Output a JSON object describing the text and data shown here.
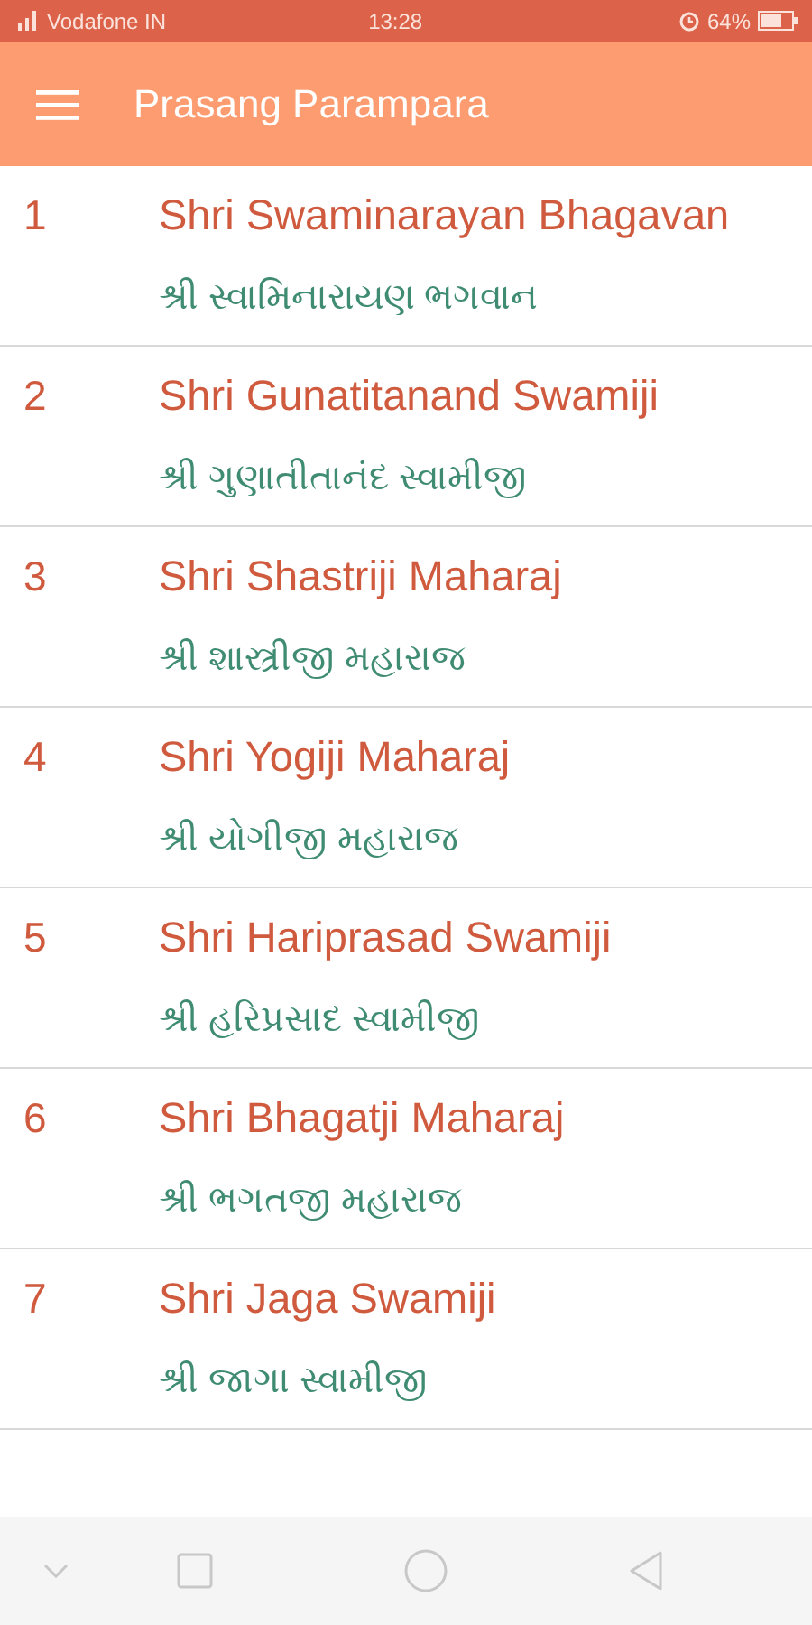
{
  "status_bar": {
    "carrier": "Vodafone IN",
    "time": "13:28",
    "battery": "64%"
  },
  "app_bar": {
    "title": "Prasang Parampara"
  },
  "items": [
    {
      "number": "1",
      "title": "Shri Swaminarayan Bhagavan",
      "subtitle": "શ્રી સ્વામિનારાયણ ભગવાન"
    },
    {
      "number": "2",
      "title": "Shri Gunatitanand Swamiji",
      "subtitle": "શ્રી ગુણાતીતાનંદ સ્વામીજી"
    },
    {
      "number": "3",
      "title": "Shri Shastriji Maharaj",
      "subtitle": "શ્રી શાસ્ત્રીજી મહારાજ"
    },
    {
      "number": "4",
      "title": "Shri Yogiji Maharaj",
      "subtitle": "શ્રી યોગીજી મહારાજ"
    },
    {
      "number": "5",
      "title": "Shri Hariprasad Swamiji",
      "subtitle": "શ્રી હરિપ્રસાદ સ્વામીજી"
    },
    {
      "number": "6",
      "title": "Shri Bhagatji Maharaj",
      "subtitle": "શ્રી ભગતજી મહારાજ"
    },
    {
      "number": "7",
      "title": "Shri Jaga Swamiji",
      "subtitle": "શ્રી જાગા સ્વામીજી"
    }
  ]
}
